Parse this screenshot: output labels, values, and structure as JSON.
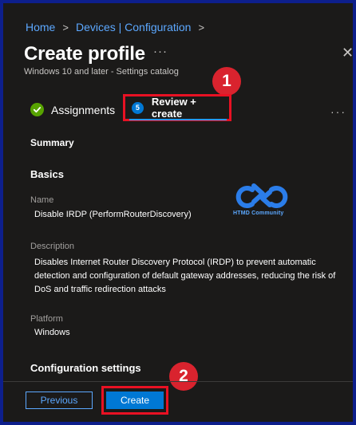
{
  "breadcrumb": {
    "items": [
      "Home",
      "Devices | Configuration"
    ],
    "separator": ">"
  },
  "header": {
    "title": "Create profile",
    "more": "···",
    "subtitle": "Windows 10 and later - Settings catalog",
    "close": "✕"
  },
  "tabs": [
    {
      "label": "Assignments",
      "state": "completed"
    },
    {
      "label": "Review + create",
      "step": "5",
      "state": "active"
    }
  ],
  "tab_more": "···",
  "callouts": {
    "one": "1",
    "two": "2"
  },
  "summary": {
    "heading": "Summary",
    "basics_heading": "Basics",
    "name_label": "Name",
    "name_value": "Disable IRDP (PerformRouterDiscovery)",
    "description_label": "Description",
    "description_value": "Disables Internet Router Discovery Protocol (IRDP) to prevent automatic detection and configuration of default gateway addresses, reducing the risk of DoS and traffic redirection attacks",
    "platform_label": "Platform",
    "platform_value": "Windows",
    "config_heading": "Configuration settings"
  },
  "watermark": {
    "text": "HTMD Community",
    "icon": "htmd-logo-icon"
  },
  "footer": {
    "previous_label": "Previous",
    "create_label": "Create"
  },
  "colors": {
    "background": "#1b1a19",
    "accent": "#0078d4",
    "link": "#5ca8ff",
    "highlight": "#e81123",
    "callout": "#d9232e",
    "success": "#57a300",
    "frame": "#0d1f8c"
  }
}
